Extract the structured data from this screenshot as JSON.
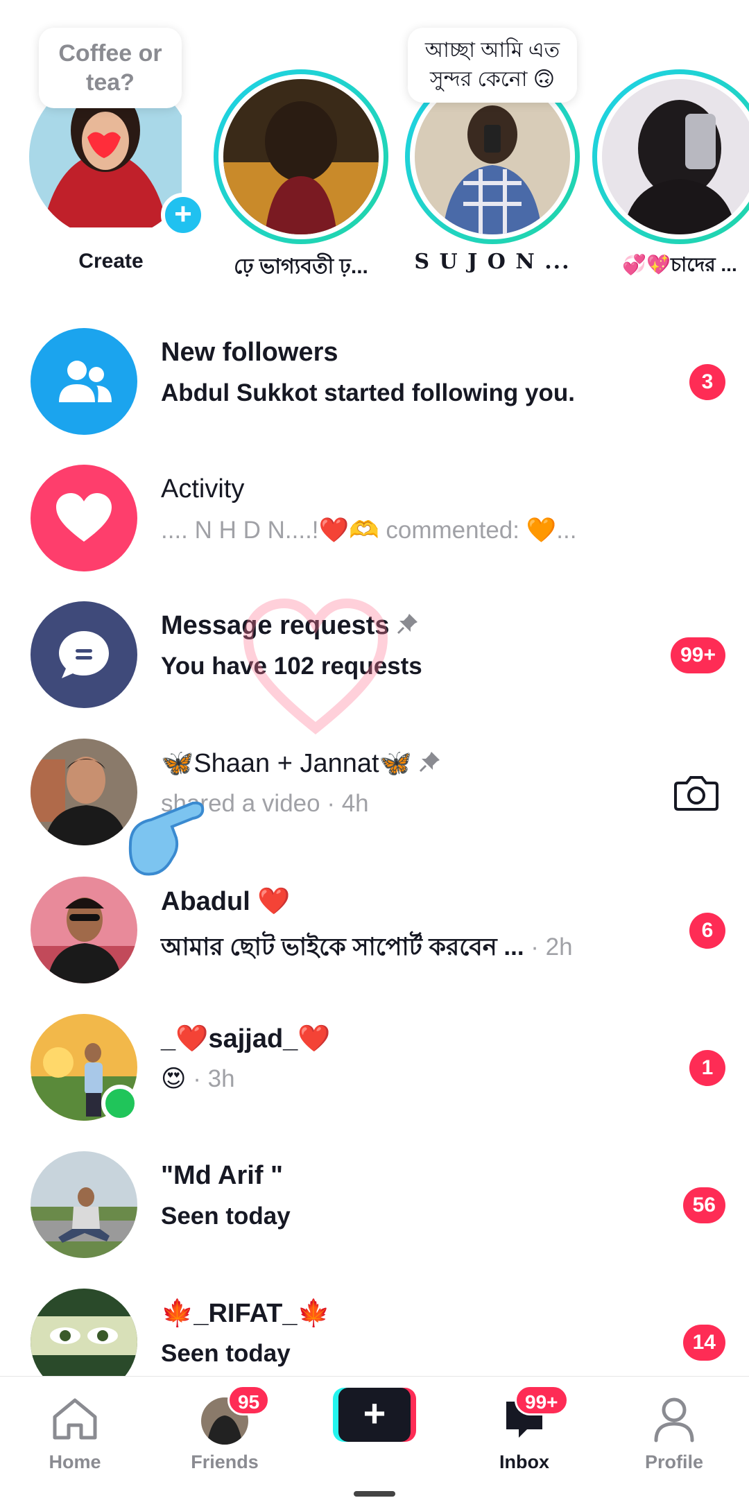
{
  "stories": [
    {
      "name": "Create",
      "bubble": "Coffee or tea?"
    },
    {
      "name": "ঢ়ে ভাগ্যবতী ঢ়...",
      "bubble": ""
    },
    {
      "name": "S U J O N ...",
      "bubble": "আচ্ছা আমি এত সুন্দর কেনো 🙃"
    },
    {
      "name": "💞💖চাদের ...",
      "bubble": ""
    }
  ],
  "rows": [
    {
      "title": "New followers",
      "sub": "Abdul Sukkot started following you.",
      "badge": "3",
      "icon": "people-icon"
    },
    {
      "title": "Activity",
      "sub": ".... N H D N....!❤️🫶 commented: 🧡...",
      "badge": "",
      "icon": "heart-icon"
    },
    {
      "title": "Message requests",
      "sub": "You have 102 requests",
      "badge": "99+",
      "icon": "chat-icon"
    },
    {
      "title": "🦋Shaan + Jannat🦋",
      "sub": "shared a video",
      "time": " · 4h",
      "badge": ""
    },
    {
      "title": "Abadul ❤️",
      "sub": "আমার ছোট ভাইকে সাপোর্ট করবেন ...",
      "time": " · 2h",
      "badge": "6"
    },
    {
      "title": "_❤️sajjad_❤️",
      "sub": "😍",
      "time": " · 3h",
      "badge": "1"
    },
    {
      "title": "\"Md Arif \"",
      "sub": "Seen today",
      "badge": "56"
    },
    {
      "title": "🍁_RIFAT_🍁",
      "sub": "Seen today",
      "badge": "14"
    }
  ],
  "nav": {
    "home": "Home",
    "friends": "Friends",
    "friends_badge": "95",
    "create": "+",
    "inbox": "Inbox",
    "inbox_badge": "99+",
    "profile": "Profile"
  },
  "colors": {
    "accent": "#fe2c55",
    "story_ring": "#1fd1e8",
    "followers_icon_bg": "#1ba4ee",
    "activity_icon_bg": "#fe3e6c",
    "requests_icon_bg": "#3f4a7a",
    "online": "#20c55a"
  }
}
